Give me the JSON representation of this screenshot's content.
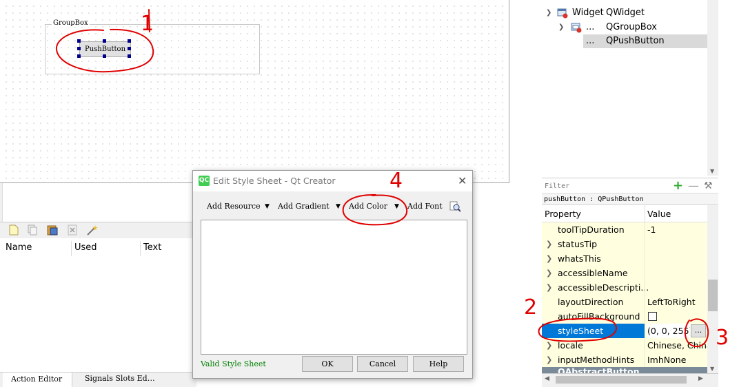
{
  "form": {
    "groupbox_title": "GroupBox",
    "pushbutton_text": "PushButton"
  },
  "object_inspector": {
    "rows": [
      {
        "name": "Widget",
        "class": "QWidget"
      },
      {
        "name": "...",
        "class": "QGroupBox"
      },
      {
        "name": "...",
        "class": "QPushButton"
      }
    ]
  },
  "property_editor": {
    "filter_placeholder": "Filter",
    "object_class": "pushButton : QPushButton",
    "col_property": "Property",
    "col_value": "Value",
    "rows": [
      {
        "name": "toolTipDuration",
        "value": "-1"
      },
      {
        "name": "statusTip",
        "value": ""
      },
      {
        "name": "whatsThis",
        "value": ""
      },
      {
        "name": "accessibleName",
        "value": ""
      },
      {
        "name": "accessibleDescripti...",
        "value": ""
      },
      {
        "name": "layoutDirection",
        "value": "LeftToRight"
      },
      {
        "name": "autoFillBackground",
        "value": ""
      },
      {
        "name": "styleSheet",
        "value": "(0, 0, 255);"
      },
      {
        "name": "locale",
        "value": "Chinese, China"
      },
      {
        "name": "inputMethodHints",
        "value": "ImhNone"
      },
      {
        "name": "QAbstractButton",
        "value": ""
      }
    ],
    "edit_button": "..."
  },
  "action_editor": {
    "columns": [
      "Name",
      "Used",
      "Text"
    ],
    "tabs": [
      "Action Editor",
      "Signals  Slots Ed…"
    ]
  },
  "dialog": {
    "icon_text": "QC",
    "title": "Edit Style Sheet - Qt Creator",
    "toolbar": [
      "Add Resource",
      "Add Gradient",
      "Add Color",
      "Add Font"
    ],
    "status": "Valid Style Sheet",
    "ok": "OK",
    "cancel": "Cancel",
    "help": "Help"
  },
  "annotations": {
    "n1": "1",
    "n2": "2",
    "n3": "3",
    "n4": "4"
  },
  "colors": {
    "annotation_red": "#e00000",
    "selection_blue": "#0078d7",
    "property_row_bg": "#ffffe0",
    "valid_green": "#008000"
  }
}
